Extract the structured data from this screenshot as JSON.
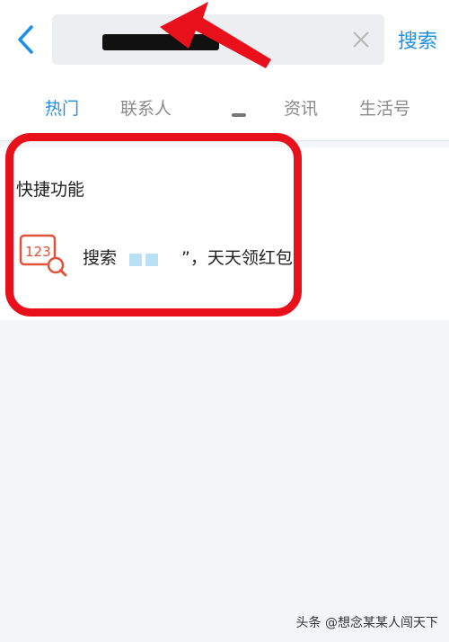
{
  "header": {
    "back_icon": "chevron-left-icon",
    "search_value": "",
    "clear_icon": "close-icon",
    "search_label": "搜索"
  },
  "tabs": [
    {
      "label": "热门",
      "active": true
    },
    {
      "label": "联系人",
      "active": false
    },
    {
      "label": "资讯",
      "active": false
    },
    {
      "label": "生活号",
      "active": false
    }
  ],
  "quick": {
    "title": "快捷功能",
    "item": {
      "icon": "number-search-icon",
      "icon_text": "123",
      "prefix": "搜索",
      "suffix": "”，天天领红包"
    }
  },
  "watermark": "头条 @想念某某人闯天下",
  "colors": {
    "accent": "#1e8fe6",
    "highlight": "#e8101a"
  }
}
